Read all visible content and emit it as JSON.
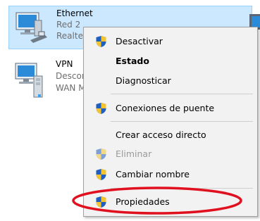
{
  "adapters": [
    {
      "name": "Ethernet",
      "line2": "Red 2",
      "line3": "Realtek PCIe GBE Family Controller",
      "icon": "network-computer-icon",
      "selected": true
    },
    {
      "name": "VPN",
      "line2": "Desconectado",
      "line3": "WAN Miniport (PPTP)",
      "icon": "vpn-connection-icon",
      "selected": false
    }
  ],
  "context_menu": {
    "items": [
      {
        "label": "Desactivar",
        "icon": "uac-shield-icon",
        "bold": false,
        "disabled": false
      },
      {
        "label": "Estado",
        "icon": "",
        "bold": true,
        "disabled": false
      },
      {
        "label": "Diagnosticar",
        "icon": "",
        "bold": false,
        "disabled": false
      },
      {
        "label": "Conexiones de puente",
        "icon": "uac-shield-icon",
        "bold": false,
        "disabled": false
      },
      {
        "label": "Crear acceso directo",
        "icon": "",
        "bold": false,
        "disabled": false
      },
      {
        "label": "Eliminar",
        "icon": "uac-shield-icon",
        "bold": false,
        "disabled": true
      },
      {
        "label": "Cambiar nombre",
        "icon": "uac-shield-icon",
        "bold": false,
        "disabled": false
      },
      {
        "label": "Propiedades",
        "icon": "uac-shield-icon",
        "bold": false,
        "disabled": false,
        "circled": true
      }
    ]
  },
  "colors": {
    "selection": "#cce8ff",
    "selection_border": "#99d1ff",
    "menu_bg": "#f2f2f2",
    "highlight_circle": "#e0101e"
  }
}
